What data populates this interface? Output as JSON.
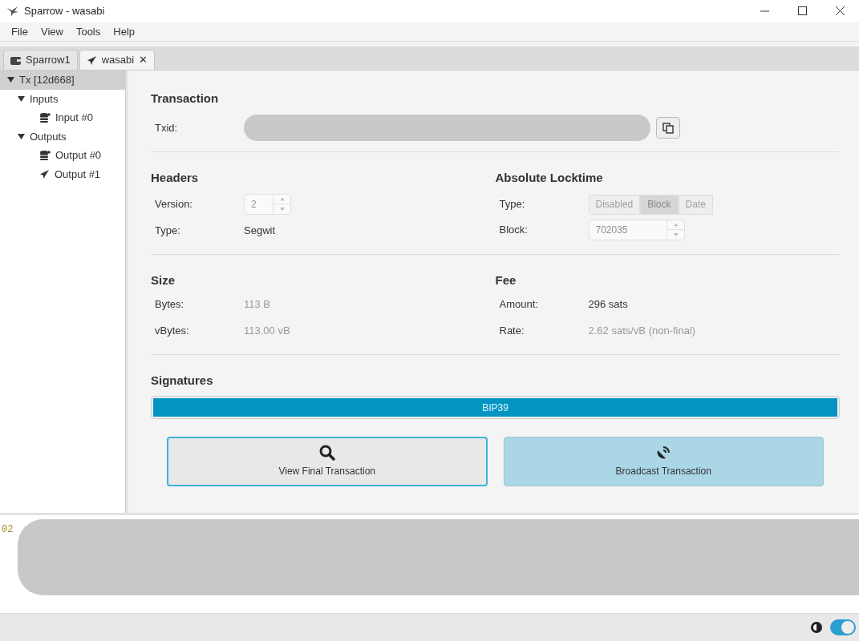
{
  "window": {
    "title": "Sparrow - wasabi"
  },
  "menu": [
    "File",
    "View",
    "Tools",
    "Help"
  ],
  "tabs": [
    {
      "label": "Sparrow1",
      "kind": "wallet",
      "selected": false
    },
    {
      "label": "wasabi",
      "kind": "transaction",
      "selected": true,
      "close": "✕"
    }
  ],
  "tree": [
    {
      "label": "Tx [12d668]",
      "expanded": true,
      "selected": true,
      "children": [
        {
          "label": "Inputs",
          "expanded": true,
          "selected": false,
          "children": [
            {
              "label": "Input #0",
              "kind": "coins",
              "selected": false
            }
          ]
        },
        {
          "label": "Outputs",
          "expanded": true,
          "selected": false,
          "children": [
            {
              "label": "Output #0",
              "kind": "coins",
              "selected": false
            },
            {
              "label": "Output #1",
              "kind": "send",
              "selected": false
            }
          ]
        }
      ]
    }
  ],
  "transaction": {
    "title": "Transaction",
    "txid_label": "Txid:"
  },
  "headers": {
    "title": "Headers",
    "version_label": "Version:",
    "version": "2",
    "type_label": "Type:",
    "type": "Segwit"
  },
  "locktime": {
    "title": "Absolute Locktime",
    "type_label": "Type:",
    "options": [
      {
        "label": "Disabled",
        "selected": false
      },
      {
        "label": "Block",
        "selected": true
      },
      {
        "label": "Date",
        "selected": false
      }
    ],
    "block_label": "Block:",
    "block": "702035"
  },
  "size": {
    "title": "Size",
    "bytes_label": "Bytes:",
    "bytes": "113 B",
    "vbytes_label": "vBytes:",
    "vbytes": "113.00 vB"
  },
  "fee": {
    "title": "Fee",
    "amount_label": "Amount:",
    "amount": "296 sats",
    "rate_label": "Rate:",
    "rate": "2.62 sats/vB (non-final)"
  },
  "signatures": {
    "title": "Signatures",
    "bar_label": "BIP39",
    "level": 1
  },
  "buttons": [
    {
      "label": "View Final Transaction",
      "kind": "view",
      "focused": true
    },
    {
      "label": "Broadcast Transaction",
      "kind": "broadcast",
      "focused": false
    }
  ],
  "hex": {
    "text": "02"
  },
  "status_bar": {
    "toggle_on": true
  }
}
